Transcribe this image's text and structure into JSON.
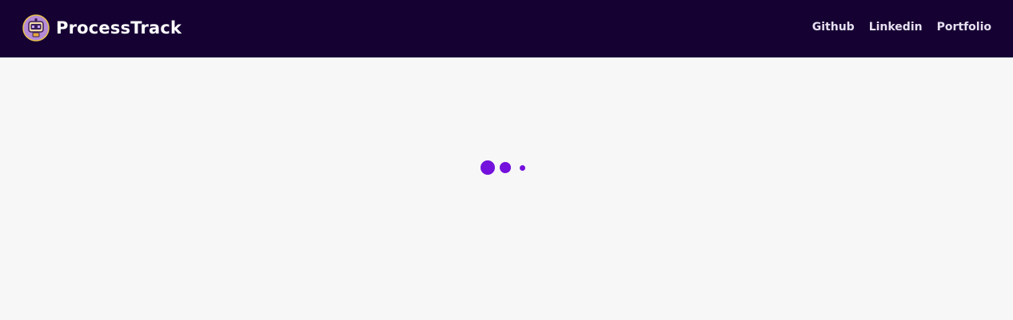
{
  "navbar": {
    "brand_name": "ProcessTrack",
    "brand_logo_icon": "robot-logo-icon",
    "links": [
      {
        "label": "Github"
      },
      {
        "label": "Linkedin"
      },
      {
        "label": "Portfolio"
      }
    ]
  },
  "loader": {
    "icon": "loading-dots-icon",
    "state": "loading"
  },
  "colors": {
    "navbar_bg": "#160133",
    "page_bg": "#f7f7f7",
    "accent": "#7411dc",
    "nav_text": "#e6e0f0"
  }
}
